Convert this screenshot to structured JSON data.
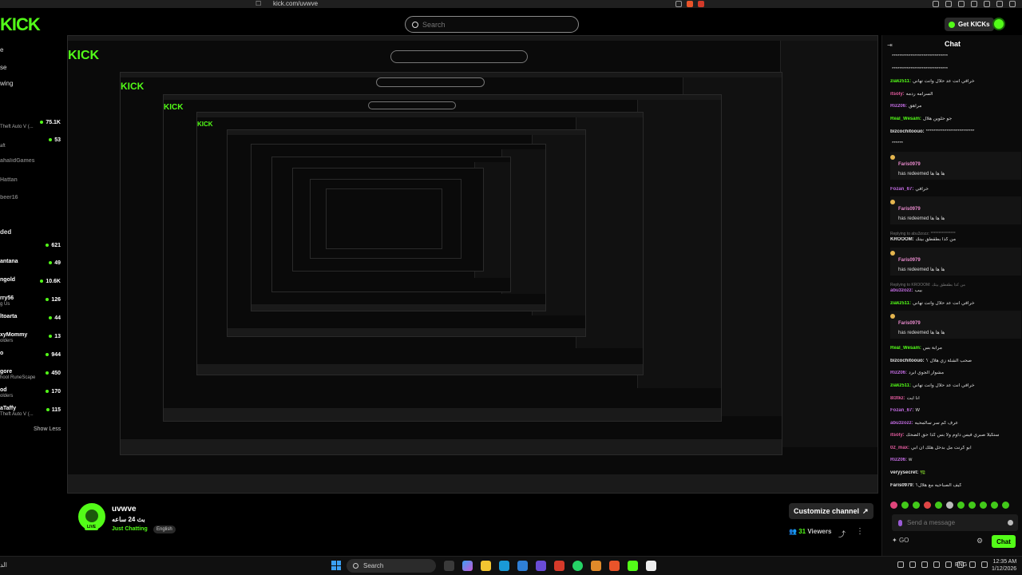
{
  "browser": {
    "url": "kick.com/uvwve"
  },
  "header": {
    "logo": "KICK",
    "search_placeholder": "Search",
    "get_kicks_label": "Get KICKs"
  },
  "sidebar": {
    "nav": [
      "e",
      "se",
      "wing"
    ],
    "recommended": [
      {
        "name": "",
        "sub": "Theft Auto V (...",
        "viewers": "75.1K"
      },
      {
        "name": "",
        "sub": "aft",
        "viewers": "53"
      },
      {
        "name": "ahalidGames",
        "sub": "",
        "viewers": ""
      },
      {
        "name": "Hattan",
        "sub": "",
        "viewers": ""
      },
      {
        "name": "beer16",
        "sub": "",
        "viewers": ""
      }
    ],
    "section_label": "ded",
    "followed": [
      {
        "name": "",
        "sub": "",
        "viewers": "621"
      },
      {
        "name": "antana",
        "sub": "",
        "viewers": "49"
      },
      {
        "name": "ngold",
        "sub": "",
        "viewers": "10.6K"
      },
      {
        "name": "rry56",
        "sub": "g Us",
        "viewers": "126"
      },
      {
        "name": "ltoarta",
        "sub": "",
        "viewers": "44"
      },
      {
        "name": "xyMommy",
        "sub": "olders",
        "viewers": "13"
      },
      {
        "name": "o",
        "sub": "",
        "viewers": "944"
      },
      {
        "name": "gore",
        "sub": "hool RuneScape",
        "viewers": "450"
      },
      {
        "name": "od",
        "sub": "olders",
        "viewers": "170"
      },
      {
        "name": "aTaffy",
        "sub": "Theft Auto V (...",
        "viewers": "115"
      }
    ],
    "show_less": "Show Less"
  },
  "streamer": {
    "name": "uvwve",
    "title": "بث 24 ساعه",
    "category": "Just Chatting",
    "tag": "English",
    "live_label": "LIVE",
    "customize_label": "Customize channel",
    "viewers_count": "31",
    "viewers_label": "Viewers"
  },
  "chat": {
    "title": "Chat",
    "messages": [
      {
        "type": "msg",
        "user": "",
        "color": "#ffffff",
        "text": "******************************"
      },
      {
        "type": "msg",
        "user": "",
        "color": "#ffffff",
        "text": "******************************"
      },
      {
        "type": "msg",
        "user": "ziakz511:",
        "color": "#53fc18",
        "text": "خرافي انت عد حلال وانت تهاني"
      },
      {
        "type": "msg",
        "user": "itsoly:",
        "color": "#e35b9e",
        "text": "السرامه ردمه"
      },
      {
        "type": "msg",
        "user": "Riz206:",
        "color": "#c06be0",
        "text": "مراهق"
      },
      {
        "type": "msg",
        "user": "Real_Wesam:",
        "color": "#53fc18",
        "text": "جو حلوين هلال"
      },
      {
        "type": "msg",
        "user": "bizcochitoouo:",
        "color": "#e5e5e5",
        "text": "**************************"
      },
      {
        "type": "msg",
        "user": "",
        "color": "#ffffff",
        "text": "******"
      },
      {
        "type": "redeem",
        "user": "Faris0979",
        "text": "has redeemed ها ها ها"
      },
      {
        "type": "msg",
        "user": "Fozan_67:",
        "color": "#c06be0",
        "text": "خرافي"
      },
      {
        "type": "redeem",
        "user": "Faris0979",
        "text": "has redeemed ها ها ها"
      },
      {
        "type": "reply",
        "text": "Replying to abu3zozz: ****************"
      },
      {
        "type": "msg",
        "user": "KROOOM:",
        "color": "#e5e5e5",
        "text": "من كذا بطقطق بيتك"
      },
      {
        "type": "redeem",
        "user": "Faris0979",
        "text": "has redeemed ها ها ها"
      },
      {
        "type": "reply",
        "text": "Replying to KROOOM: من كذا بطقطق بيتك"
      },
      {
        "type": "msg",
        "user": "abu3zozz:",
        "color": "#c06be0",
        "text": "بيب"
      },
      {
        "type": "msg",
        "user": "ziakz511:",
        "color": "#53fc18",
        "text": "خرافي انت عد حلال وانت تهاني"
      },
      {
        "type": "redeem",
        "user": "Faris0979",
        "text": "has redeemed ها ها ها"
      },
      {
        "type": "msg",
        "user": "Real_Wesam:",
        "color": "#53fc18",
        "text": "مرابة بس"
      },
      {
        "type": "msg",
        "user": "bizcochitoouo:",
        "color": "#e5e5e5",
        "text": "صحب الشلة زي هلال ؟"
      },
      {
        "type": "msg",
        "user": "Riz206:",
        "color": "#c06be0",
        "text": "مشوار الجوي ابرد"
      },
      {
        "type": "msg",
        "user": "ziakz511:",
        "color": "#53fc18",
        "text": "خرافي انت عد حلال وانت تهاني"
      },
      {
        "type": "msg",
        "user": "8l3tkz:",
        "color": "#e35b9e",
        "text": "انا ايت"
      },
      {
        "type": "msg",
        "user": "Fozan_67:",
        "color": "#c06be0",
        "text": "W"
      },
      {
        "type": "msg",
        "user": "abu3zozz:",
        "color": "#c06be0",
        "text": "عرف كم سر سالمحيه"
      },
      {
        "type": "msg",
        "user": "itsoly:",
        "color": "#e35b9e",
        "text": "ستكيلا صبري فيس داوم ولا بس كذا حق الضحك"
      },
      {
        "type": "msg",
        "user": "02_max:",
        "color": "#e35b9e",
        "text": "ابو كرنت مل بدخل هلك ان ابي"
      },
      {
        "type": "msg",
        "user": "Riz206:",
        "color": "#c06be0",
        "text": "w"
      },
      {
        "type": "msg",
        "user": "veryysecret:",
        "color": "#e5e5e5",
        "text": "🌿"
      },
      {
        "type": "msg",
        "user": "Faris0979:",
        "color": "#e5e5e5",
        "text": "كيف الصباحيه مع هلال؟"
      }
    ],
    "send_placeholder": "Send a message",
    "footer_label": "GO",
    "chat_button": "Chat"
  },
  "taskbar": {
    "left_text": "الد",
    "search_label": "Search",
    "lang": "ENG",
    "time": "12:35 AM",
    "date": "1/12/2026"
  }
}
